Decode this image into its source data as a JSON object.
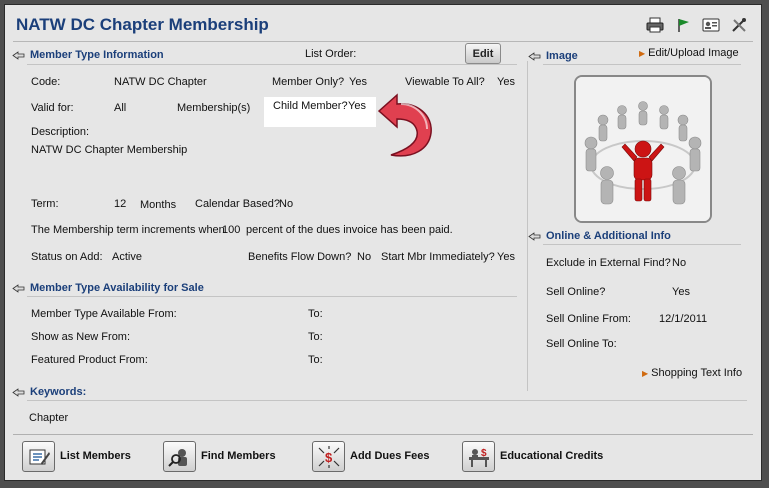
{
  "window": {
    "title": "NATW DC Chapter Membership"
  },
  "toolbar_icons": [
    "printer-icon",
    "flag-icon",
    "id-card-icon",
    "tools-icon"
  ],
  "member_type": {
    "section_title": "Member Type Information",
    "list_order_label": "List Order:",
    "edit_label": "Edit",
    "code_label": "Code:",
    "code_value": "NATW DC Chapter",
    "member_only_label": "Member Only?",
    "member_only_value": "Yes",
    "viewable_label": "Viewable To All?",
    "viewable_value": "Yes",
    "valid_for_label": "Valid for:",
    "valid_for_value": "All",
    "memberships_label": "Membership(s)",
    "child_member_label": "Child Member?",
    "child_member_value": "Yes",
    "description_label": "Description:",
    "description_value": "NATW DC Chapter Membership",
    "term_label": "Term:",
    "term_value": "12",
    "term_unit": "Months",
    "calendar_label": "Calendar Based?",
    "calendar_value": "No",
    "increment_prefix": "The Membership term increments when",
    "increment_value": "100",
    "increment_suffix": "percent of the dues invoice has been paid.",
    "status_label": "Status on Add:",
    "status_value": "Active",
    "benefits_label": "Benefits Flow Down?",
    "benefits_value": "No",
    "start_label": "Start Mbr Immediately?",
    "start_value": "Yes"
  },
  "availability": {
    "section_title": "Member Type Availability for Sale",
    "rows": [
      {
        "label": "Member Type Available From:",
        "to": "To:"
      },
      {
        "label": "Show as New From:",
        "to": "To:"
      },
      {
        "label": "Featured Product From:",
        "to": "To:"
      }
    ]
  },
  "keywords": {
    "section_title": "Keywords:",
    "value": "Chapter"
  },
  "image": {
    "section_title": "Image",
    "edit_link": "Edit/Upload Image"
  },
  "online": {
    "section_title": "Online & Additional Info",
    "exclude_label": "Exclude in External Find?",
    "exclude_value": "No",
    "sell_online_label": "Sell Online?",
    "sell_online_value": "Yes",
    "sell_from_label": "Sell Online From:",
    "sell_from_value": "12/1/2011",
    "sell_to_label": "Sell Online To:",
    "shopping_link": "Shopping Text Info"
  },
  "bottom_buttons": [
    {
      "label": "List Members",
      "icon": "list-members-icon"
    },
    {
      "label": "Find Members",
      "icon": "find-members-icon"
    },
    {
      "label": "Add Dues Fees",
      "icon": "add-dues-icon"
    },
    {
      "label": "Educational Credits",
      "icon": "educational-credits-icon"
    }
  ],
  "colors": {
    "section_title": "#1b3f7a",
    "callout_arrow": "#e04050",
    "link_marker": "#d06a10"
  }
}
